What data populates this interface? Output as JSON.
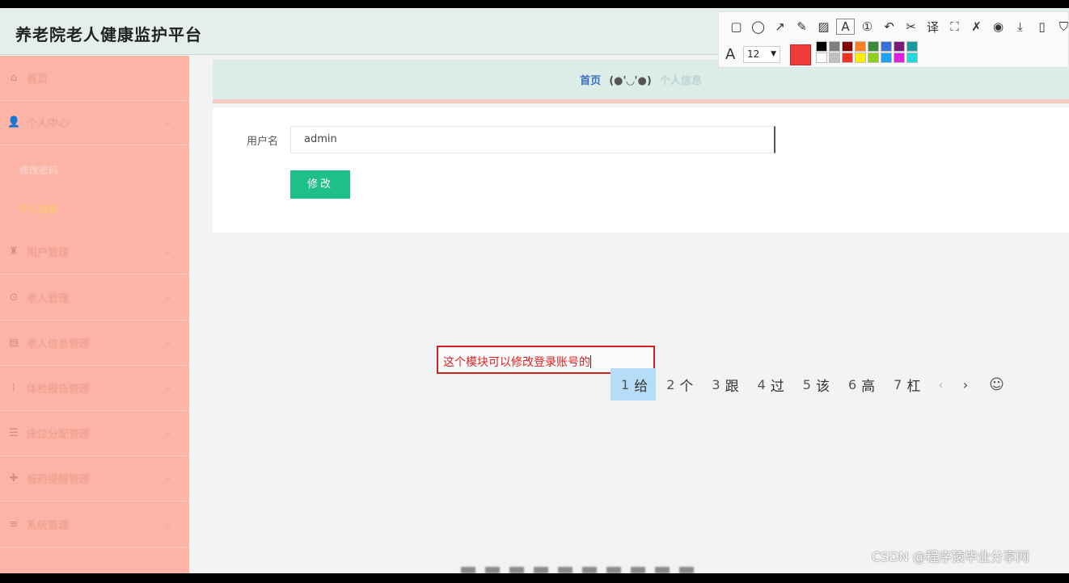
{
  "app": {
    "title": "养老院老人健康监护平台"
  },
  "toolbar": {
    "tools": [
      {
        "name": "rectangle-tool-icon",
        "glyph": "▢"
      },
      {
        "name": "ellipse-tool-icon",
        "glyph": "◯"
      },
      {
        "name": "arrow-tool-icon",
        "glyph": "↗"
      },
      {
        "name": "pencil-tool-icon",
        "glyph": "✎"
      },
      {
        "name": "mosaic-tool-icon",
        "glyph": "▨"
      },
      {
        "name": "text-tool-icon",
        "glyph": "A"
      },
      {
        "name": "number-tool-icon",
        "glyph": "①"
      },
      {
        "name": "undo-icon",
        "glyph": "↶"
      },
      {
        "name": "scissors-icon",
        "glyph": "✂"
      },
      {
        "name": "translate-icon",
        "glyph": "译"
      },
      {
        "name": "ocr-icon",
        "glyph": "⛶"
      },
      {
        "name": "pin-icon",
        "glyph": "✗"
      },
      {
        "name": "record-icon",
        "glyph": "◉"
      },
      {
        "name": "download-icon",
        "glyph": "⤓"
      },
      {
        "name": "phone-icon",
        "glyph": "▯"
      },
      {
        "name": "bookmark-icon",
        "glyph": "⛉"
      }
    ],
    "font_size": "12",
    "current_color": "#ef3b3b",
    "palette": [
      "#000000",
      "#808080",
      "#800000",
      "#ff7f27",
      "#3a8a3a",
      "#3a6fd8",
      "#7a1a7a",
      "#1a9a9a",
      "#ffffff",
      "#c0c0c0",
      "#ee3322",
      "#ffee00",
      "#8ed11a",
      "#22a2ee",
      "#e020e0",
      "#22d8d8"
    ]
  },
  "sidebar": {
    "items": [
      {
        "label": "首页",
        "icon": "home-icon",
        "glyph": "⌂",
        "arrow": false
      },
      {
        "label": "个人中心",
        "icon": "user-icon",
        "glyph": "👤",
        "arrow": true
      },
      {
        "label": "用户管理",
        "icon": "user-manage-icon",
        "glyph": "♜",
        "arrow": true
      },
      {
        "label": "老人管理",
        "icon": "elder-icon",
        "glyph": "⊙",
        "arrow": true
      },
      {
        "label": "老人信息管理",
        "icon": "info-icon",
        "glyph": "▤",
        "arrow": true
      },
      {
        "label": "体检报告管理",
        "icon": "report-icon",
        "glyph": "⁞",
        "arrow": true
      },
      {
        "label": "床位分配管理",
        "icon": "bed-icon",
        "glyph": "☰",
        "arrow": true
      },
      {
        "label": "服药提醒管理",
        "icon": "medicine-icon",
        "glyph": "✚",
        "arrow": true
      },
      {
        "label": "系统管理",
        "icon": "system-icon",
        "glyph": "≡",
        "arrow": true
      }
    ],
    "sub_items": [
      {
        "label": "修改密码",
        "color": "#f6dcd5"
      },
      {
        "label": "个人信息",
        "color": "#f7d25a"
      }
    ]
  },
  "breadcrumb": {
    "home": "首页",
    "face": "(●'◡'●)",
    "current": "个人信息"
  },
  "form": {
    "username_label": "用户名",
    "username_value": "admin",
    "save_label": "修改"
  },
  "annotation": {
    "text": "这个模块可以修改登录账号的"
  },
  "ime": {
    "candidates": [
      {
        "num": "1",
        "text": "给"
      },
      {
        "num": "2",
        "text": "个"
      },
      {
        "num": "3",
        "text": "跟"
      },
      {
        "num": "4",
        "text": "过"
      },
      {
        "num": "5",
        "text": "该"
      },
      {
        "num": "6",
        "text": "高"
      },
      {
        "num": "7",
        "text": "杠"
      }
    ],
    "prev": "‹",
    "next": "›",
    "emoji": "☺"
  },
  "watermark": "CSDN @程序猿毕业分享网"
}
